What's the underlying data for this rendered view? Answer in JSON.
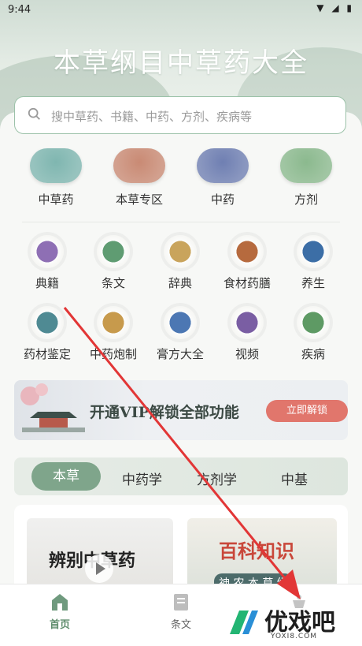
{
  "status": {
    "time": "9:44",
    "icons": "▼ ◢ ▮"
  },
  "header": {
    "title": "本草纲目中草药大全"
  },
  "search": {
    "placeholder": "搜中草药、书籍、中药、方剂、疾病等"
  },
  "top_categories": [
    {
      "label": "中草药",
      "icon": "leaf-icon",
      "color": "#7fb6b0"
    },
    {
      "label": "本草专区",
      "icon": "herb-leaf-icon",
      "color": "#c98a74"
    },
    {
      "label": "中药",
      "icon": "mortar-icon",
      "color": "#6f7fb2"
    },
    {
      "label": "方剂",
      "icon": "book-icon",
      "color": "#8bb98e"
    }
  ],
  "grid": [
    {
      "label": "典籍",
      "icon": "classic-book-icon",
      "color": "#8e6fb4"
    },
    {
      "label": "条文",
      "icon": "article-icon",
      "color": "#5f9c72"
    },
    {
      "label": "辞典",
      "icon": "dictionary-icon",
      "color": "#c9a45c"
    },
    {
      "label": "食材药膳",
      "icon": "bowl-icon",
      "color": "#b66a3e"
    },
    {
      "label": "养生",
      "icon": "jar-icon",
      "color": "#3c6ea6"
    },
    {
      "label": "药材鉴定",
      "icon": "scan-icon",
      "color": "#4f8a93"
    },
    {
      "label": "中药炮制",
      "icon": "mortar-bowl-icon",
      "color": "#c79a4c"
    },
    {
      "label": "膏方大全",
      "icon": "hand-leaf-icon",
      "color": "#4c77b3"
    },
    {
      "label": "视频",
      "icon": "play-icon",
      "color": "#7a5ea3"
    },
    {
      "label": "疾病",
      "icon": "clover-icon",
      "color": "#5e9a64"
    }
  ],
  "banner": {
    "text": "开通VIP解锁全部功能",
    "button": "立即解锁"
  },
  "tabs": [
    "本草",
    "中药学",
    "方剂学",
    "中基"
  ],
  "media": {
    "card1_text": "辨别中草药",
    "card2_text": "百科知识",
    "card2_sub": "神 农 本 草 经"
  },
  "bottom_nav": [
    {
      "label": "首页",
      "icon": "home-icon",
      "active": true
    },
    {
      "label": "条文",
      "icon": "article-nav-icon",
      "active": false
    },
    {
      "label": "",
      "icon": "mortar-nav-icon",
      "active": false
    }
  ],
  "watermark": {
    "text": "优戏吧",
    "sub": "YOXI8.COM"
  },
  "colors": {
    "accent": "#7fa58b",
    "arrow": "#e23636",
    "banner_button": "#e1766c"
  }
}
